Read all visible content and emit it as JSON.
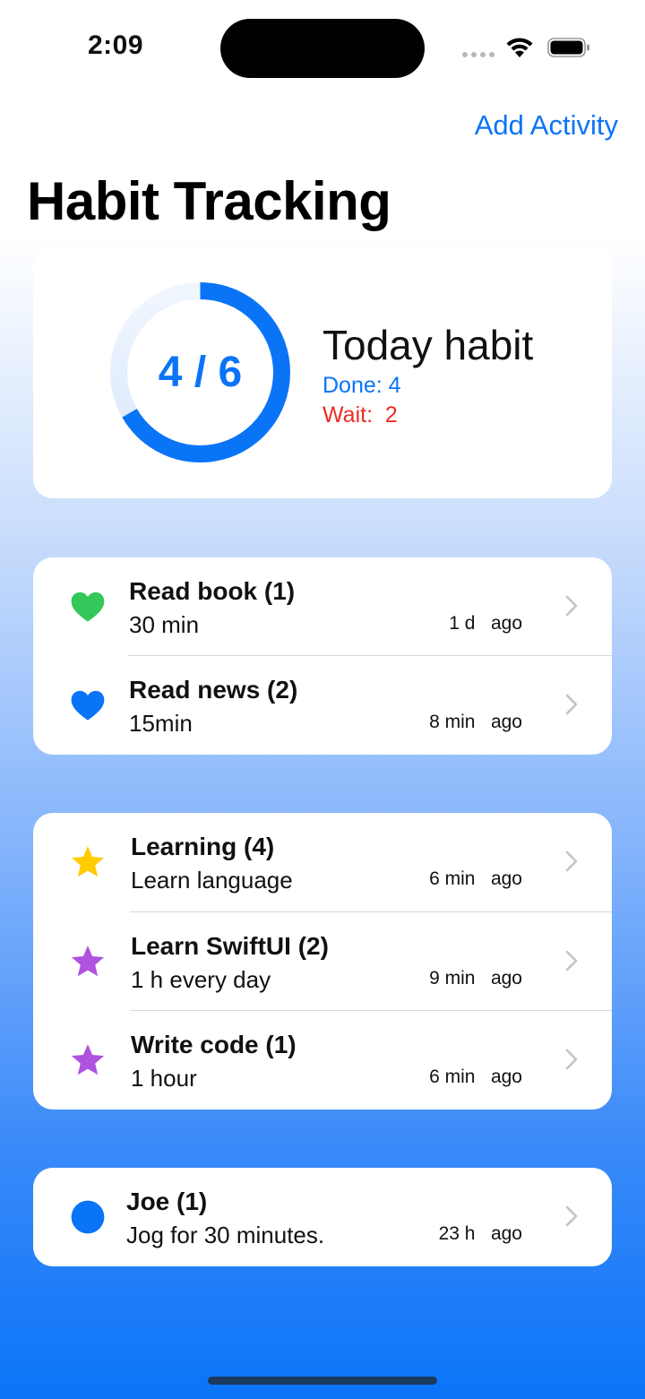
{
  "status_bar": {
    "time": "2:09",
    "icons": [
      "cellular-icon",
      "wifi-icon",
      "battery-icon"
    ]
  },
  "header": {
    "add_label": "Add Activity",
    "title": "Habit Tracking"
  },
  "summary": {
    "done_count": 4,
    "total_count": 6,
    "progress_text": "4 / 6",
    "title": "Today habit",
    "done_label": "Done: 4",
    "wait_label": "Wait:  2",
    "colors": {
      "accent": "#0a74f7",
      "wait": "#ee2b24"
    }
  },
  "groups": [
    {
      "items": [
        {
          "icon": "heart-icon",
          "color": "#34c759",
          "title": "Read book (1)",
          "subtitle": "30 min",
          "elapsed": "1 d   ago"
        },
        {
          "icon": "heart-icon",
          "color": "#0a74f7",
          "title": "Read news (2)",
          "subtitle": "15min",
          "elapsed": "8 min   ago"
        }
      ]
    },
    {
      "items": [
        {
          "icon": "star-icon",
          "color": "#ffcc00",
          "title": "Learning (4)",
          "subtitle": "Learn language",
          "elapsed": "6 min   ago"
        },
        {
          "icon": "star-icon",
          "color": "#af52de",
          "title": "Learn SwiftUI (2)",
          "subtitle": "1 h every day",
          "elapsed": "9 min   ago"
        },
        {
          "icon": "star-icon",
          "color": "#af52de",
          "title": "Write code (1)",
          "subtitle": "1 hour",
          "elapsed": "6 min   ago"
        }
      ]
    },
    {
      "items": [
        {
          "icon": "circle-icon",
          "color": "#0a74f7",
          "title": "Joe (1)",
          "subtitle": "Jog for 30 minutes.",
          "elapsed": "23 h   ago"
        }
      ]
    }
  ]
}
